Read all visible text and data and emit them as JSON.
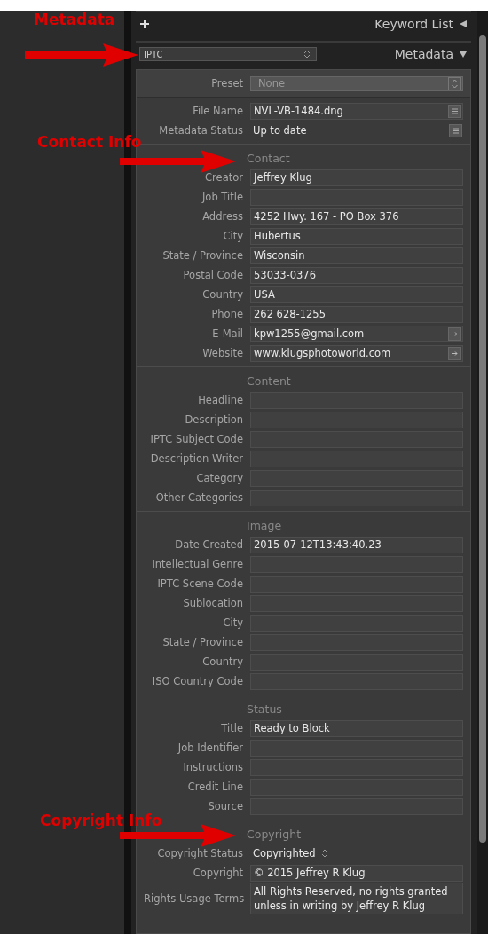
{
  "keyword_list": {
    "title": "Keyword List",
    "expanded": false
  },
  "metadata_header": {
    "set": "IPTC",
    "title": "Metadata",
    "expanded": true
  },
  "preset": {
    "label": "Preset",
    "value": "None"
  },
  "info_rows": [
    {
      "label": "File Name",
      "value": "NVL-VB-1484.dng",
      "kind": "field-menu"
    },
    {
      "label": "Metadata Status",
      "value": "Up to date",
      "kind": "text-menu"
    }
  ],
  "sections": [
    {
      "title": "Contact",
      "fields": [
        {
          "label": "Creator",
          "value": "Jeffrey Klug",
          "kind": "field"
        },
        {
          "label": "Job Title",
          "kind": "field"
        },
        {
          "label": "Address",
          "value": "4252 Hwy. 167 - PO Box 376",
          "kind": "field"
        },
        {
          "label": "City",
          "value": "Hubertus",
          "kind": "field"
        },
        {
          "label": "State / Province",
          "value": "Wisconsin",
          "kind": "field"
        },
        {
          "label": "Postal Code",
          "value": "53033-0376",
          "kind": "field"
        },
        {
          "label": "Country",
          "value": "USA",
          "kind": "field"
        },
        {
          "label": "Phone",
          "value": "262 628-1255",
          "kind": "field"
        },
        {
          "label": "E-Mail",
          "value": "kpw1255@gmail.com",
          "kind": "field-link"
        },
        {
          "label": "Website",
          "value": "www.klugsphotoworld.com",
          "kind": "field-link"
        }
      ]
    },
    {
      "title": "Content",
      "fields": [
        {
          "label": "Headline",
          "kind": "field"
        },
        {
          "label": "Description",
          "kind": "field"
        },
        {
          "label": "IPTC Subject Code",
          "kind": "field"
        },
        {
          "label": "Description Writer",
          "kind": "field"
        },
        {
          "label": "Category",
          "kind": "field"
        },
        {
          "label": "Other Categories",
          "kind": "field"
        }
      ]
    },
    {
      "title": "Image",
      "fields": [
        {
          "label": "Date Created",
          "value": "2015-07-12T13:43:40.23",
          "kind": "field"
        },
        {
          "label": "Intellectual Genre",
          "kind": "field"
        },
        {
          "label": "IPTC Scene Code",
          "kind": "field"
        },
        {
          "label": "Sublocation",
          "kind": "field"
        },
        {
          "label": "City",
          "kind": "field"
        },
        {
          "label": "State / Province",
          "kind": "field"
        },
        {
          "label": "Country",
          "kind": "field"
        },
        {
          "label": "ISO Country Code",
          "kind": "field"
        }
      ]
    },
    {
      "title": "Status",
      "fields": [
        {
          "label": "Title",
          "value": "Ready to Block",
          "kind": "field"
        },
        {
          "label": "Job Identifier",
          "kind": "field"
        },
        {
          "label": "Instructions",
          "kind": "field"
        },
        {
          "label": "Credit Line",
          "kind": "field"
        },
        {
          "label": "Source",
          "kind": "field"
        }
      ]
    },
    {
      "title": "Copyright",
      "fields": [
        {
          "label": "Copyright Status",
          "value": "Copyrighted",
          "kind": "popup"
        },
        {
          "label": "Copyright",
          "value": "©  2015 Jeffrey R Klug",
          "kind": "field"
        },
        {
          "label": "Rights Usage Terms",
          "value": "All Rights Reserved, no rights granted unless in writing by Jeffrey R Klug",
          "kind": "textarea"
        }
      ]
    }
  ],
  "annotations": [
    {
      "text": "Metadata"
    },
    {
      "text": "Contact Info"
    },
    {
      "text": "Copyright Info"
    }
  ]
}
